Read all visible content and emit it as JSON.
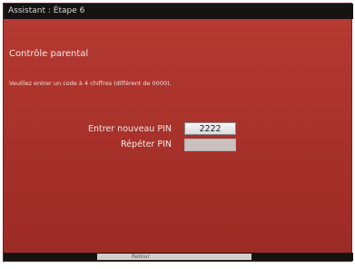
{
  "window": {
    "title": "Assistant : Étape 6"
  },
  "section": {
    "heading": "Contrôle parental",
    "instruction": "Veuillez entrer un code à 4 chiffres (différent de 0000)."
  },
  "form": {
    "new_pin_label": "Entrer nouveau PIN",
    "new_pin_value": "2222",
    "repeat_pin_label": "Répéter PIN",
    "repeat_pin_value": ""
  },
  "footer": {
    "hint": "Retour"
  },
  "colors": {
    "background_red": "#a7312a",
    "title_bar": "#171313",
    "field_active": "#f5f5f5",
    "field_inactive": "#c9c1c0"
  }
}
